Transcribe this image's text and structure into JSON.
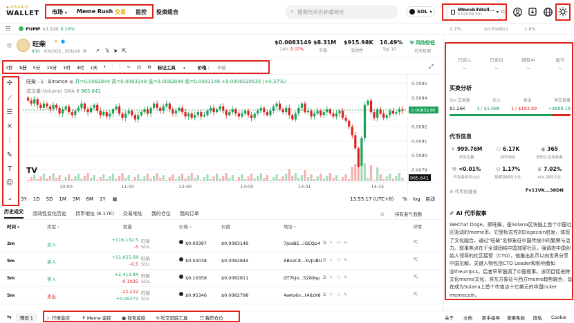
{
  "brand": {
    "sub": "◆ BINANCE",
    "main": "WALLET"
  },
  "nav": {
    "market": "市场",
    "meme_rush": "Meme Rush",
    "trade": "交易",
    "monitor": "监控",
    "portfolio": "投资组合"
  },
  "search": {
    "placeholder": "搜索代币名称或地址"
  },
  "chain": {
    "label": "SOL"
  },
  "wallet": {
    "name": "BNweb3Wall...",
    "balance": "0.021006 SOL"
  },
  "subbar": {
    "token": "PUMP",
    "price": "$3.52B",
    "change": "0.19%",
    "right1": "1.7%",
    "right2": "$0.034611",
    "right3": "1.8%"
  },
  "token": {
    "name": "旺柴",
    "age": "43d",
    "address": "83kGGS...bDborb",
    "price": "$0.0083149",
    "price_label": "24h",
    "price_change": "-5.07%",
    "mcap": "$8.31M",
    "mcap_label": "市值",
    "liquidity": "$915.98K",
    "liquidity_label": "流动性",
    "holders": "16.49%",
    "holders_label": "Top 10",
    "risk": "风险较低",
    "risk_label": "代币检测"
  },
  "chart_toolbar": {
    "items": [
      "1秒",
      "1分",
      "5分",
      "15分",
      "1时",
      "4时",
      "1天"
    ],
    "indicators": "标记工具",
    "price_toggle": "价格",
    "mcap_toggle": "市值"
  },
  "chart_overlay": {
    "line1": "旺柴 · 1 · Binance",
    "o": "开=0.0082844",
    "h": "高=0.0083149",
    "l": "低=0.0082844",
    "c": "收=0.0083149",
    "chg": "+0.0000030535 (+0.37%)",
    "vol_label": "成交量(Volume) SMA 9",
    "vol_value": "965.641"
  },
  "chart_bottom": {
    "ranges": [
      "3Y",
      "1D",
      "5D",
      "1M",
      "3M",
      "6M",
      "1Y"
    ],
    "time": "13:55:17 (UTC+8)",
    "pct": "%",
    "log": "log",
    "auto": "自动"
  },
  "chart_data": {
    "type": "candlestick",
    "x_ticks": [
      "10:00",
      "11:00",
      "12:00",
      "13:00",
      "13:31",
      "14:15"
    ],
    "y_ticks": [
      "0.0085",
      "0.0084",
      "0.0083",
      "0.0082",
      "0.0081",
      "0.0080",
      "0.0079"
    ],
    "ylim": [
      0.00785,
      0.00855
    ],
    "last_price": "0.0083149",
    "volume_last": "965.641",
    "close": [
      0.00838,
      0.00836,
      0.00839,
      0.00835,
      0.00833,
      0.00836,
      0.00834,
      0.00832,
      0.00835,
      0.00833,
      0.00829,
      0.00832,
      0.00834,
      0.0083,
      0.00828,
      0.00831,
      0.00833,
      0.00836,
      0.00832,
      0.0083,
      0.00833,
      0.00835,
      0.00831,
      0.00828,
      0.0083,
      0.00827,
      0.00829,
      0.00832,
      0.00834,
      0.00829,
      0.00826,
      0.00829,
      0.00831,
      0.00828,
      0.00825,
      0.00828,
      0.0083,
      0.00832,
      0.00829,
      0.00833,
      0.00836,
      0.00833,
      0.00831,
      0.00834,
      0.00836,
      0.00832,
      0.00829,
      0.00831,
      0.00833,
      0.0083,
      0.00827,
      0.00829,
      0.00826,
      0.00828,
      0.0083,
      0.00827,
      0.00828,
      0.00831,
      0.00833,
      0.0083,
      0.00832,
      0.00834,
      0.00831,
      0.00828,
      0.0083,
      0.00832,
      0.00829,
      0.00827,
      0.00829,
      0.00831,
      0.00828,
      0.00826,
      0.00829,
      0.00831,
      0.00833,
      0.0083,
      0.00828,
      0.00831,
      0.00834,
      0.00836,
      0.00832,
      0.0083,
      0.00833,
      0.00828,
      0.00825,
      0.00829,
      0.00833,
      0.00836,
      0.0083,
      0.00831,
      0.00827,
      0.00829,
      0.00831,
      0.00828,
      0.0083,
      0.00832,
      0.00829,
      0.00827,
      0.00829,
      0.00831,
      0.00826,
      0.00824,
      0.0082,
      0.00814,
      0.00805,
      0.00792,
      0.00812,
      0.00835,
      0.00838,
      0.0083,
      0.00826,
      0.00832,
      0.00829,
      0.00826,
      0.00828,
      0.00831,
      0.00829,
      0.0083,
      0.00832,
      0.00831
    ]
  },
  "tabs": [
    "历史成交",
    "流动性变化历史",
    "持币地址 (6.17K)",
    "交易地址",
    "我的仓位",
    "我的订单"
  ],
  "tabs_right": "持有者气泡图",
  "table": {
    "headers": {
      "time": "时间",
      "type": "类型",
      "qty": "数量",
      "price": "价格",
      "value": "价值",
      "addr": "地址",
      "detail": "详情"
    },
    "rows": [
      {
        "time": "2m",
        "type": "买入",
        "q1": "+116,132.5",
        "q1u": "旺柴",
        "q2": "-5",
        "q2u": "SOL",
        "price": "$0.00397",
        "value": "$0.0083149",
        "addr": "7JoaBE...iGEQp4"
      },
      {
        "time": "5m",
        "type": "买入",
        "q1": "+11,655.68",
        "q1u": "旺柴",
        "q2": "-0.5",
        "q2u": "SOL",
        "price": "$0.50038",
        "value": "$0.0082844",
        "addr": "ABozC8...4VJUBU"
      },
      {
        "time": "5m",
        "type": "买入",
        "q1": "+2,413.84",
        "q1u": "旺柴",
        "q2": "-0.1035",
        "q2u": "SOL",
        "price": "$0.10358",
        "value": "$0.0082811",
        "addr": "GT7kjo...5289sp"
      },
      {
        "time": "5m",
        "type": "卖出",
        "q1": "-22,222",
        "q1u": "旺柴",
        "q2": "+0.95272",
        "q2u": "SOL",
        "price": "$0.95346",
        "value": "$0.0082798",
        "addr": "4wKs6v...t46zX6"
      }
    ]
  },
  "right_panel": {
    "stats": [
      {
        "label": "已买入",
        "value": "--"
      },
      {
        "label": "已卖出",
        "value": "--"
      },
      {
        "label": "持有中",
        "value": "--"
      },
      {
        "label": "盈亏",
        "value": "--"
      }
    ],
    "analysis_title": "买卖分析",
    "analysis": {
      "vol_label": "5m 交易量",
      "vol": "$1.26K",
      "buy_label": "买入",
      "buy": "3 / $1.08K",
      "sell_label": "卖出",
      "sell": "1 / $183.99",
      "net_label": "净交易量",
      "net": "+$898.19",
      "buy_fraction": 0.85
    },
    "info_title": "代币信息",
    "info": [
      {
        "value": "999.76M",
        "label": "总供应量",
        "icon": "supply-icon"
      },
      {
        "value": "6.17K",
        "label": "持币地址",
        "icon": "holders-icon"
      },
      {
        "value": "365",
        "label": "身份认证持有者",
        "icon": "eye-icon"
      },
      {
        "value": "<0.01%",
        "label": "开发者持币占比",
        "icon": "dev-icon"
      },
      {
        "value": "1.17%",
        "label": "聪明钱持币占比",
        "icon": "smart-money-icon"
      },
      {
        "value": "7.02%",
        "label": "KOL 持币占比",
        "icon": "kol-icon"
      }
    ],
    "creator_label": "代币创建者",
    "creator": "Fv11VK...38DN",
    "ai_title": "AI 代币叙事",
    "ai_text": "WeChat Doge，即旺柴，是Solana区块链上首个中国社区驱动的meme币。它受标志性的Dogecoin启发，体现了文化融合，通过\"旺柴\"名称象征中国传统中的繁荣与活力。叙事焦点在于全球团结中国加密社区，强调由中国创始人领导的社区接管（CTO），他推出此币以向世界分享中国见解，关键人物包括CTO Leader和影响者如@theunipcs，后者早早强调了中国叙事。该项目促进跨文化meme文化，将东方象征与西方meme趋势融合，旨在成为Solana上首个市值达十亿美元的中国ticker memecoin。"
  },
  "footer": {
    "preset": "预设 1",
    "items": [
      "行情监控",
      "Meme 监控",
      "钱包监控",
      "社交追踪工具",
      "我的仓位"
    ],
    "links": [
      "关于",
      "文档",
      "新手指导",
      "使用条款",
      "隐私",
      "Cookie"
    ]
  }
}
